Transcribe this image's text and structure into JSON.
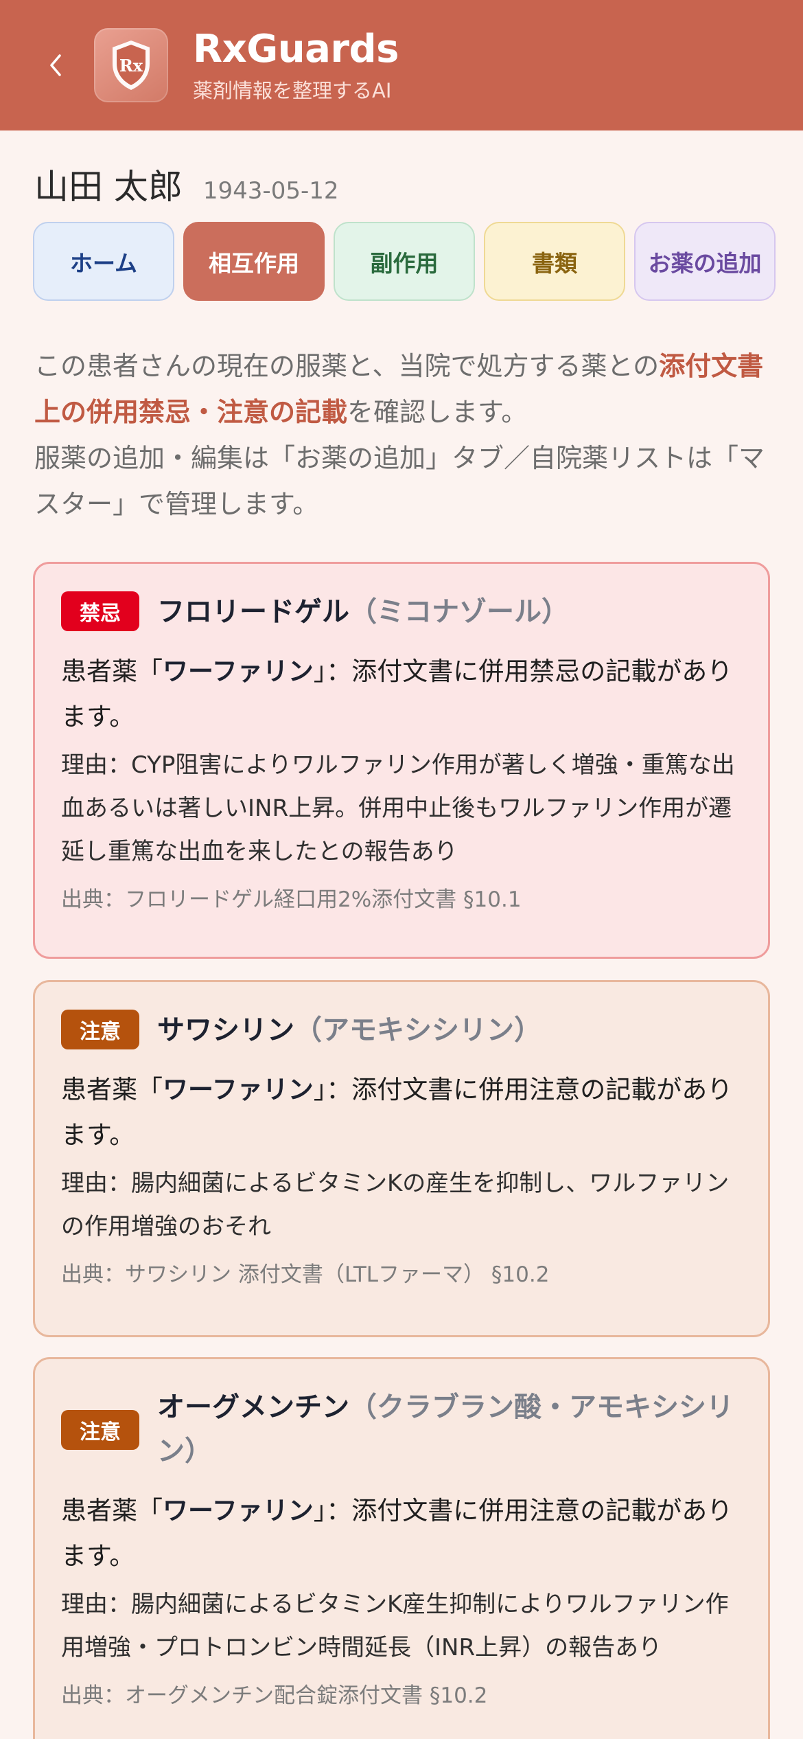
{
  "header": {
    "title": "RxGuards",
    "subtitle": "薬剤情報を整理するAI",
    "logo_text": "Rx",
    "back_icon": "chevron-left-icon"
  },
  "patient": {
    "name": "山田 太郎",
    "dob": "1943-05-12"
  },
  "tabs": [
    {
      "label": "ホーム",
      "active": false
    },
    {
      "label": "相互作用",
      "active": true
    },
    {
      "label": "副作用",
      "active": false
    },
    {
      "label": "書類",
      "active": false
    },
    {
      "label": "お薬の追加",
      "active": false
    }
  ],
  "intro": {
    "line1_pre": "この患者さんの現在の服薬と、当院で処方する薬との",
    "line1_highlight": "添付文書上の併用禁忌・注意の記載",
    "line1_post": "を確認します。",
    "line2": "服薬の追加・編集は「お薬の追加」タブ／自院薬リストは「マスター」で管理します。"
  },
  "cards": [
    {
      "level": "禁忌",
      "drug_name": "フロリードゲル",
      "generic": "（ミコナゾール）",
      "patient_drug_pre": "患者薬「",
      "patient_drug": "ワーファリン",
      "patient_drug_post": "」：添付文書に併用禁忌の記載があります。",
      "reason": "理由：CYP阻害によりワルファリン作用が著しく増強・重篤な出血あるいは著しいINR上昇。併用中止後もワルファリン作用が遷延し重篤な出血を来したとの報告あり",
      "source": "出典：フロリードゲル経口用2%添付文書 §10.1"
    },
    {
      "level": "注意",
      "drug_name": "サワシリン",
      "generic": "（アモキシシリン）",
      "patient_drug_pre": "患者薬「",
      "patient_drug": "ワーファリン",
      "patient_drug_post": "」：添付文書に併用注意の記載があります。",
      "reason": "理由：腸内細菌によるビタミンKの産生を抑制し、ワルファリンの作用増強のおそれ",
      "source": "出典：サワシリン 添付文書（LTLファーマ） §10.2"
    },
    {
      "level": "注意",
      "drug_name": "オーグメンチン",
      "generic": "（クラブラン酸・アモキシシリン）",
      "patient_drug_pre": "患者薬「",
      "patient_drug": "ワーファリン",
      "patient_drug_post": "」：添付文書に併用注意の記載があります。",
      "reason": "理由：腸内細菌によるビタミンK産生抑制によりワルファリン作用増強・プロトロンビン時間延長（INR上昇）の報告あり",
      "source": "出典：オーグメンチン配合錠添付文書 §10.2"
    }
  ],
  "colors": {
    "header_bg": "#c8644f",
    "page_bg": "#fcf3f0",
    "contra_badge": "#e2001d",
    "caution_badge": "#b5520d",
    "highlight": "#c05a43"
  }
}
